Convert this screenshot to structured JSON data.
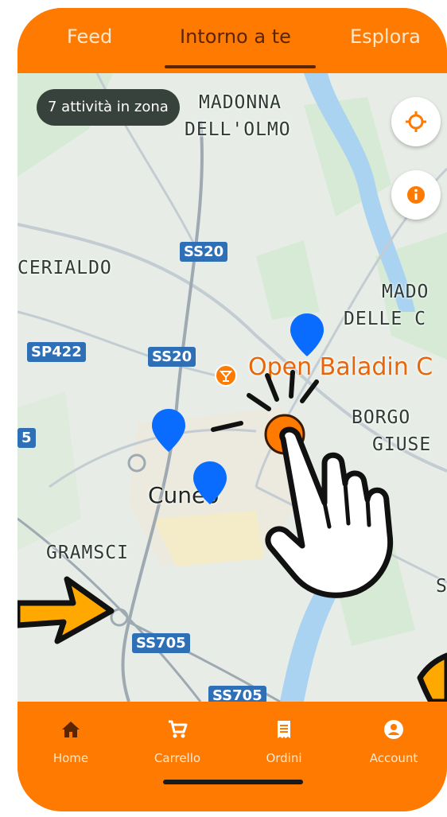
{
  "tabs": [
    {
      "label": "Feed",
      "active": false
    },
    {
      "label": "Intorno a te",
      "active": true
    },
    {
      "label": "Esplora",
      "active": false
    }
  ],
  "map": {
    "activity_count": "7 attività in zona",
    "place_labels": {
      "madonna_olmo_1": "MADONNA",
      "madonna_olmo_2": "DELL'OLMO",
      "cerialdo": "CERIALDO",
      "madonna_delle_1": "MADO",
      "madonna_delle_2": "DELLE C",
      "borgo_1": "BORGO",
      "borgo_2": "GIUSE",
      "cuneo": "Cuneo",
      "gramsci": "GRAMSCI",
      "edge_s": "S"
    },
    "road_shields": {
      "ss20_a": "SS20",
      "ss20_b": "SS20",
      "sp422": "SP422",
      "ss705_a": "SS705",
      "ss705_b": "SS705",
      "edge_5": "5"
    },
    "poi_label": "Open Baladin C",
    "locate_icon": "crosshair-icon",
    "info_icon": "info-icon",
    "pin_color": "#0a6cff",
    "selected_pin_color": "#ff7a00"
  },
  "bottom_nav": [
    {
      "label": "Home",
      "icon": "home-icon",
      "active": true
    },
    {
      "label": "Carrello",
      "icon": "cart-icon",
      "active": false
    },
    {
      "label": "Ordini",
      "icon": "receipt-icon",
      "active": false
    },
    {
      "label": "Account",
      "icon": "account-icon",
      "active": false
    }
  ],
  "colors": {
    "brand": "#ff7a00",
    "active_tab": "#5a2500",
    "arrow": "#ffa800"
  }
}
